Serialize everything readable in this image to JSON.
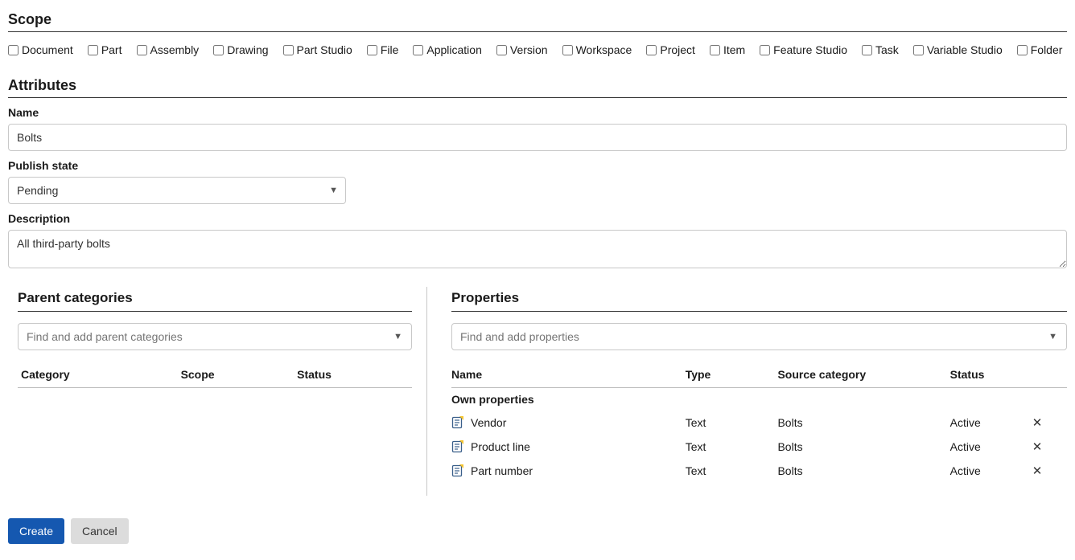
{
  "scope": {
    "title": "Scope",
    "items": [
      {
        "label": "Document",
        "checked": false
      },
      {
        "label": "Part",
        "checked": false
      },
      {
        "label": "Assembly",
        "checked": false
      },
      {
        "label": "Drawing",
        "checked": false
      },
      {
        "label": "Part Studio",
        "checked": false
      },
      {
        "label": "File",
        "checked": false
      },
      {
        "label": "Application",
        "checked": false
      },
      {
        "label": "Version",
        "checked": false
      },
      {
        "label": "Workspace",
        "checked": false
      },
      {
        "label": "Project",
        "checked": false
      },
      {
        "label": "Item",
        "checked": false
      },
      {
        "label": "Feature Studio",
        "checked": false
      },
      {
        "label": "Task",
        "checked": false
      },
      {
        "label": "Variable Studio",
        "checked": false
      },
      {
        "label": "Folder",
        "checked": false
      }
    ]
  },
  "attributes": {
    "title": "Attributes",
    "name_label": "Name",
    "name_value": "Bolts",
    "publish_state_label": "Publish state",
    "publish_state_value": "Pending",
    "description_label": "Description",
    "description_value": "All third-party bolts"
  },
  "parent_categories": {
    "title": "Parent categories",
    "search_placeholder": "Find and add parent categories",
    "columns": [
      "Category",
      "Scope",
      "Status"
    ]
  },
  "properties": {
    "title": "Properties",
    "search_placeholder": "Find and add properties",
    "columns": [
      "Name",
      "Type",
      "Source category",
      "Status",
      ""
    ],
    "own_header": "Own properties",
    "rows": [
      {
        "name": "Vendor",
        "type": "Text",
        "source": "Bolts",
        "status": "Active"
      },
      {
        "name": "Product line",
        "type": "Text",
        "source": "Bolts",
        "status": "Active"
      },
      {
        "name": "Part number",
        "type": "Text",
        "source": "Bolts",
        "status": "Active"
      }
    ]
  },
  "footer": {
    "create_label": "Create",
    "cancel_label": "Cancel"
  }
}
